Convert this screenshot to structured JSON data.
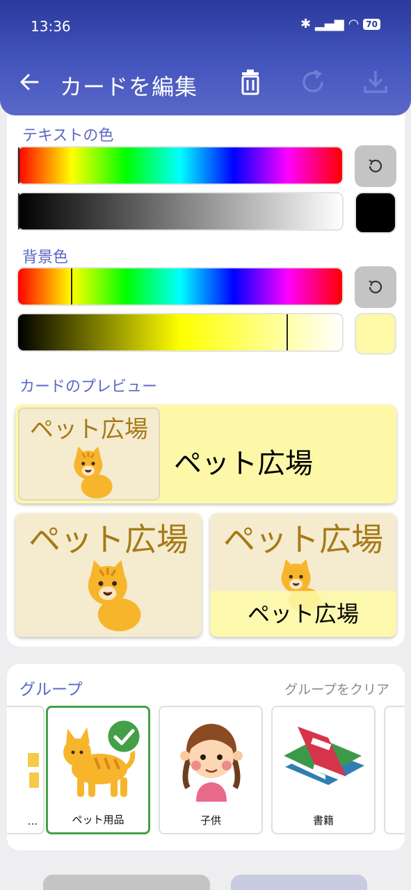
{
  "status": {
    "time": "13:36",
    "battery": "70"
  },
  "appbar": {
    "title": "カードを編集"
  },
  "text_color": {
    "label": "テキストの色"
  },
  "bg_color": {
    "label": "背景色"
  },
  "preview": {
    "label": "カードのプレビュー",
    "card_text": "ペット広場"
  },
  "group": {
    "label": "グループ",
    "clear": "グループをクリア",
    "items": [
      {
        "label": "..."
      },
      {
        "label": "ペット用品"
      },
      {
        "label": "子供"
      },
      {
        "label": "書籍"
      }
    ]
  },
  "colors": {
    "accent": "#4455bd",
    "selected": "#43a047",
    "card_bg": "#fcf8a8"
  }
}
